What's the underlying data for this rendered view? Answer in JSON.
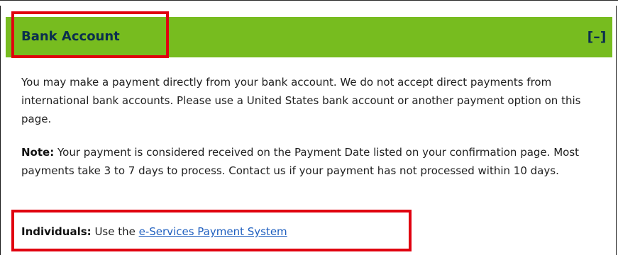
{
  "section": {
    "title": "Bank Account",
    "toggle_label": "[–]"
  },
  "content": {
    "paragraph1": "You may make a payment directly from your bank account. We do not accept direct payments from international bank accounts. Please use a United States bank account or another payment option on this page.",
    "note_label": "Note:",
    "note_text": " Your payment is considered received on the Payment Date listed on your confirmation page. Most payments take 3 to 7 days to process. Contact us if your payment has not processed within 10 days.",
    "individuals_label": "Individuals:",
    "individuals_text": " Use the ",
    "link_text": "e-Services Payment System"
  },
  "colors": {
    "header_bg": "#77bc1f",
    "title_text": "#0b2e4e",
    "highlight": "#e0000f",
    "link": "#1f5fbf"
  }
}
